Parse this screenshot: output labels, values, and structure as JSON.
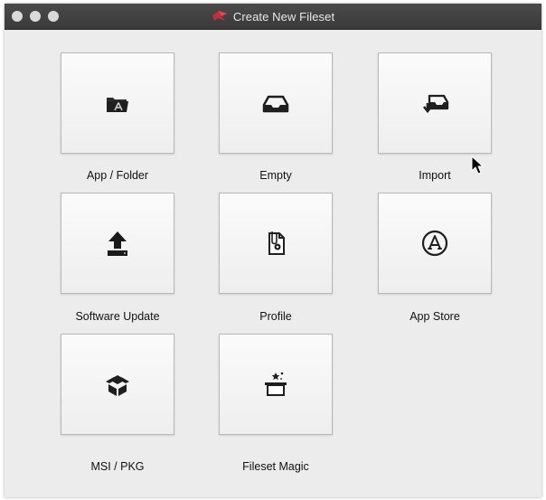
{
  "window": {
    "title": "Create New Fileset",
    "title_icon": "red-ribbon-logo-icon"
  },
  "tiles": [
    {
      "label": "App / Folder",
      "icon": "app-folder-icon"
    },
    {
      "label": "Empty",
      "icon": "empty-tray-icon"
    },
    {
      "label": "Import",
      "icon": "import-tray-icon"
    },
    {
      "label": "Software Update",
      "icon": "upload-arrow-icon"
    },
    {
      "label": "Profile",
      "icon": "profile-document-icon"
    },
    {
      "label": "App Store",
      "icon": "app-store-icon"
    },
    {
      "label": "MSI / PKG",
      "icon": "package-box-icon"
    },
    {
      "label": "Fileset Magic",
      "icon": "magic-box-icon"
    }
  ],
  "colors": {
    "titlebar": "#3f3f3f",
    "background": "#ececec",
    "tile_border": "#b9b9b9",
    "logo": "#c0303a"
  }
}
